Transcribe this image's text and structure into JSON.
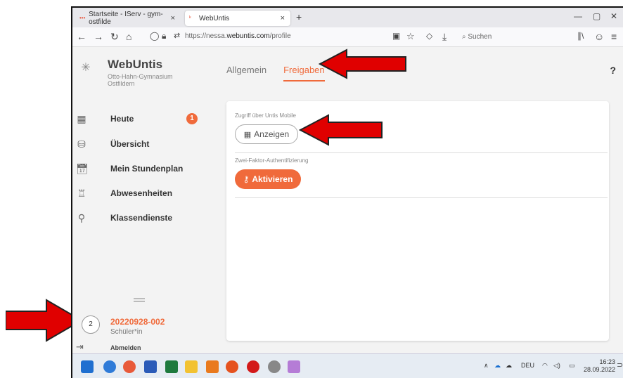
{
  "browser": {
    "tab_inactive": "Startseite - IServ - gym-ostfilde",
    "tab_active": "WebUntis",
    "new_tab": "+",
    "tab_close": "×",
    "url_prefix": "https://nessa.",
    "url_domain": "webuntis.com",
    "url_path": "/profile",
    "search_placeholder": "Suchen"
  },
  "app": {
    "brand": "WebUntis",
    "school": "Otto-Hahn-Gymnasium Ostfildern",
    "menu": [
      {
        "label": "Heute",
        "icon": "dashboard-icon"
      },
      {
        "label": "Übersicht",
        "icon": "overview-icon"
      },
      {
        "label": "Mein Stundenplan",
        "icon": "calendar-icon"
      },
      {
        "label": "Abwesenheiten",
        "icon": "chair-icon"
      },
      {
        "label": "Klassendienste",
        "icon": "service-icon"
      }
    ],
    "badge_count": "1",
    "user": {
      "avatar": "2",
      "name": "20220928-002",
      "role": "Schüler*in"
    },
    "logout": "Abmelden",
    "tabs": [
      "Allgemein",
      "Freigaben"
    ],
    "help": "?",
    "section1_label": "Zugriff über Untis Mobile",
    "section1_button": "Anzeigen",
    "section2_label": "Zwei-Faktor-Authentifizierung",
    "section2_button": "Aktivieren"
  },
  "taskbar": {
    "lang": "DEU",
    "time": "16:23",
    "date": "28.09.2022"
  },
  "colors": {
    "accent": "#f06a3b",
    "arrow": "#e00000"
  }
}
